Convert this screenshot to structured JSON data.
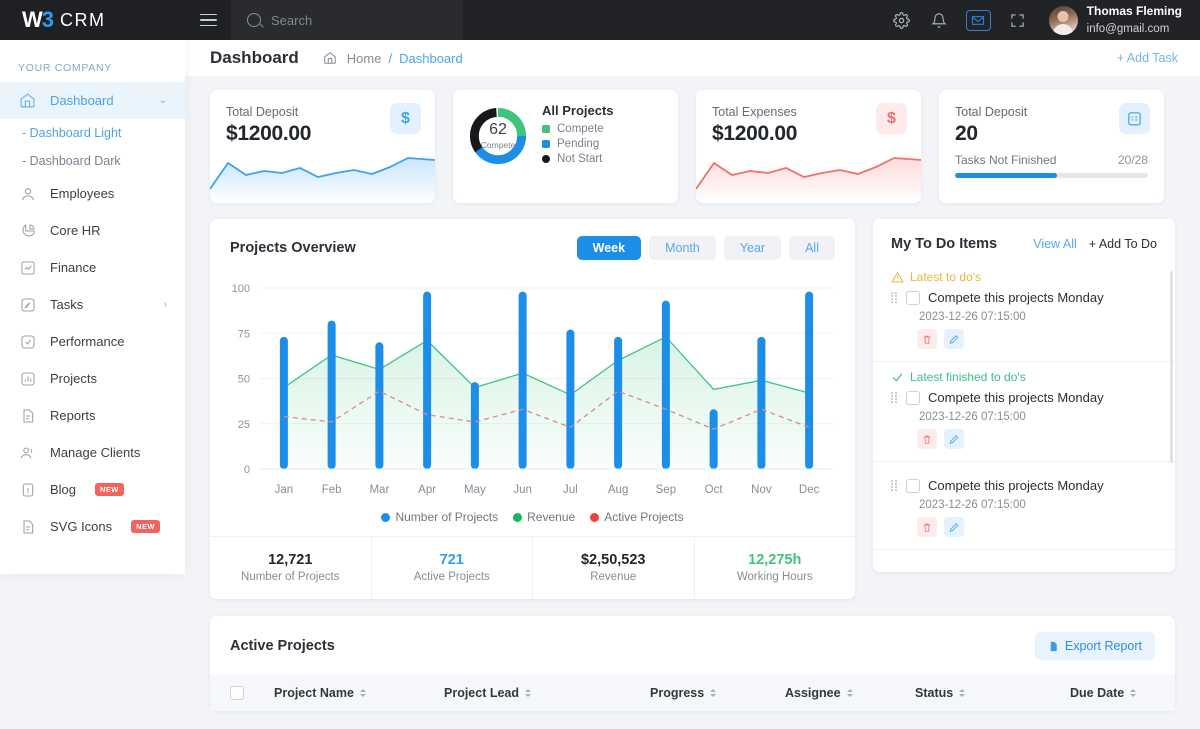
{
  "brand": {
    "logo_mark": "W",
    "logo_accent": "3",
    "name": "CRM"
  },
  "topbar": {
    "search_placeholder": "Search",
    "icons": [
      "gear-icon",
      "bell-icon",
      "mail-icon",
      "fullscreen-icon"
    ],
    "user": {
      "name": "Thomas Fleming",
      "email": "info@gmail.com"
    }
  },
  "sidebar": {
    "section_label": "YOUR COMPANY",
    "items": [
      {
        "label": "Dashboard",
        "icon": "home-icon",
        "active": true,
        "chevron": "⌄"
      },
      {
        "label": "Employees",
        "icon": "user-icon"
      },
      {
        "label": "Core HR",
        "icon": "pie-icon"
      },
      {
        "label": "Finance",
        "icon": "chart-icon"
      },
      {
        "label": "Tasks",
        "icon": "edit-icon",
        "chevron": "›"
      },
      {
        "label": "Performance",
        "icon": "check-icon"
      },
      {
        "label": "Projects",
        "icon": "bars-icon"
      },
      {
        "label": "Reports",
        "icon": "doc-icon"
      },
      {
        "label": "Manage Clients",
        "icon": "users-icon"
      },
      {
        "label": "Blog",
        "icon": "info-icon",
        "badge": "NEW"
      },
      {
        "label": "SVG Icons",
        "icon": "file-icon",
        "badge": "NEW"
      }
    ],
    "subitems": [
      {
        "label": "- Dashboard Light",
        "active": true
      },
      {
        "label": "- Dashboard Dark",
        "active": false
      }
    ]
  },
  "pagehead": {
    "title": "Dashboard",
    "crumb_home": "Home",
    "crumb_sep": "/",
    "crumb_current": "Dashboard",
    "add_task": "+ Add Task"
  },
  "cards": {
    "deposit": {
      "label": "Total Deposit",
      "value": "$1200.00",
      "icon": "$"
    },
    "projects": {
      "title": "All Projects",
      "center_value": "62",
      "center_caption": "Compete",
      "legend": [
        {
          "label": "Compete",
          "color": "#3ec47c",
          "pct": 25
        },
        {
          "label": "Pending",
          "color": "#1c8ee8",
          "pct": 40
        },
        {
          "label": "Not Start",
          "color": "#16181b",
          "pct": 35
        }
      ]
    },
    "expenses": {
      "label": "Total Expenses",
      "value": "$1200.00",
      "icon": "$"
    },
    "tasks": {
      "label": "Total Deposit",
      "value": "20",
      "sub_label": "Tasks Not Finished",
      "sub_value": "20/28",
      "progress_pct": 53,
      "icon": "clipboard-icon"
    }
  },
  "chart_panel": {
    "title": "Projects Overview",
    "segments": [
      {
        "label": "Week",
        "active": true
      },
      {
        "label": "Month",
        "active": false
      },
      {
        "label": "Year",
        "active": false
      },
      {
        "label": "All",
        "active": false
      }
    ],
    "stats": [
      {
        "value": "12,721",
        "label": "Number of Projects",
        "color": "#22262d"
      },
      {
        "value": "721",
        "label": "Active Projects",
        "color": "#2f9cf4"
      },
      {
        "value": "$2,50,523",
        "label": "Revenue",
        "color": "#22262d"
      },
      {
        "value": "12,275h",
        "label": "Working Hours",
        "color": "#3ec47c"
      }
    ]
  },
  "chart_data": {
    "type": "bar",
    "title": "Projects Overview",
    "xlabel": "",
    "ylabel": "",
    "ylim": [
      0,
      100
    ],
    "yticks": [
      0,
      25,
      50,
      75,
      100
    ],
    "grid": true,
    "legend_position": "bottom",
    "categories": [
      "Jan",
      "Feb",
      "Mar",
      "Apr",
      "May",
      "Jun",
      "Jul",
      "Aug",
      "Sep",
      "Oct",
      "Nov",
      "Dec"
    ],
    "series": [
      {
        "name": "Number of Projects",
        "type": "bar",
        "color": "#1c8ee8",
        "values": [
          73,
          82,
          70,
          98,
          48,
          98,
          77,
          73,
          93,
          33,
          73,
          98
        ]
      },
      {
        "name": "Revenue",
        "type": "area",
        "color": "#3ec47c",
        "values": [
          45,
          63,
          55,
          71,
          45,
          53,
          41,
          60,
          73,
          44,
          49,
          42
        ]
      },
      {
        "name": "Active Projects",
        "type": "line-dashed",
        "color": "#f2706e",
        "values": [
          29,
          26,
          43,
          30,
          26,
          33,
          23,
          43,
          33,
          22,
          33,
          23
        ]
      }
    ]
  },
  "todo": {
    "title": "My To Do Items",
    "view_all": "View All",
    "add_todo": "+ Add To Do",
    "sections": [
      {
        "label": "Latest to do's",
        "kind": "warn",
        "icon": "warning-icon"
      },
      {
        "label": "Latest finished to do's",
        "kind": "done",
        "icon": "check-icon"
      }
    ],
    "items": [
      {
        "text": "Compete this projects Monday",
        "date": "2023-12-26 07:15:00",
        "section": 0
      },
      {
        "text": "Compete this projects Monday",
        "date": "2023-12-26 07:15:00",
        "section": 1
      },
      {
        "text": "Compete this projects Monday",
        "date": "2023-12-26 07:15:00",
        "section": null
      }
    ],
    "row_icons": [
      "trash-icon",
      "edit-icon"
    ]
  },
  "table": {
    "title": "Active Projects",
    "export_label": "Export Report",
    "columns": [
      "Project Name",
      "Project Lead",
      "Progress",
      "Assignee",
      "Status",
      "Due Date"
    ]
  },
  "colors": {
    "accent": "#1c8ee8",
    "green": "#3ec47c",
    "red": "#f2706e",
    "dark": "#1f2023",
    "page_bg": "#f2f4f8"
  }
}
